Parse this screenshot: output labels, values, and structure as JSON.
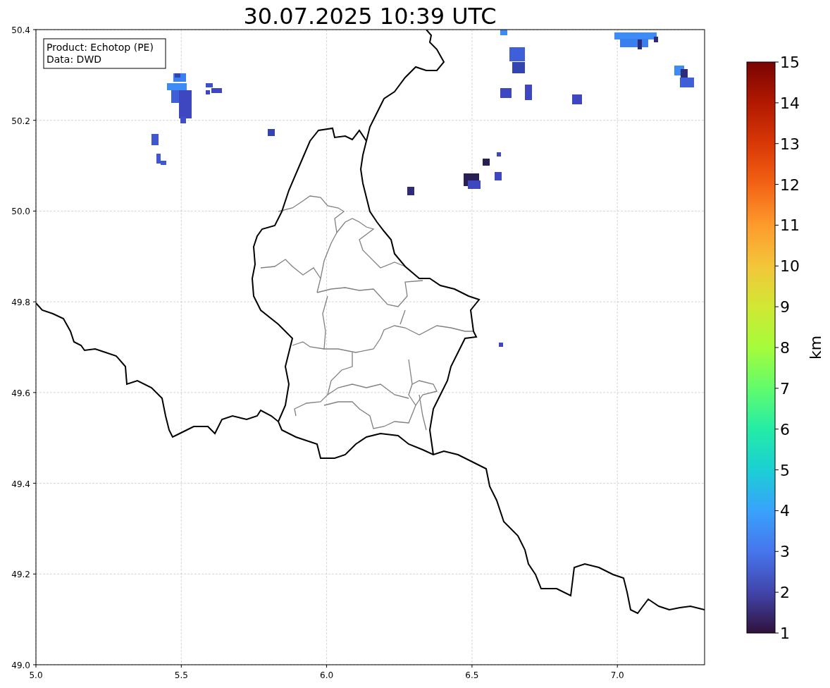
{
  "title": "30.07.2025 10:39 UTC",
  "info_box": {
    "lines": [
      "Product: Echotop (PE)",
      "Data: DWD"
    ]
  },
  "x_ticks": [
    "5.0",
    "5.5",
    "6.0",
    "6.5",
    "7.0"
  ],
  "y_ticks": [
    "50.4",
    "50.2",
    "50.0",
    "49.8",
    "49.6",
    "49.4",
    "49.2",
    "49.0"
  ],
  "colorbar": {
    "label": "km",
    "ticks": [
      "15",
      "14",
      "13",
      "12",
      "11",
      "10",
      "9",
      "8",
      "7",
      "6",
      "5",
      "4",
      "3",
      "2",
      "1"
    ]
  }
}
